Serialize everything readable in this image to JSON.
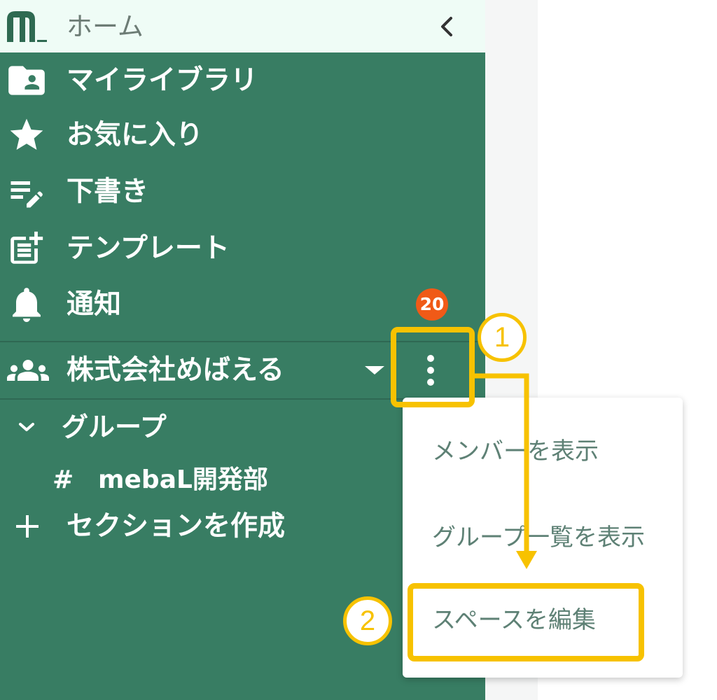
{
  "colors": {
    "sidebar_bg": "#387d63",
    "header_bg": "#effcf6",
    "badge_bg": "#f05a17",
    "annotation": "#f7c200",
    "menu_text": "#5e8175"
  },
  "header": {
    "title": "ホーム",
    "logo_icon": "app-logo-icon",
    "collapse_icon": "chevron-left-icon"
  },
  "nav": {
    "items": [
      {
        "label": "マイライブラリ",
        "icon": "library-icon"
      },
      {
        "label": "お気に入り",
        "icon": "star-icon"
      },
      {
        "label": "下書き",
        "icon": "draft-icon"
      },
      {
        "label": "テンプレート",
        "icon": "template-icon"
      },
      {
        "label": "通知",
        "icon": "bell-icon",
        "badge": "20"
      }
    ]
  },
  "space": {
    "name": "株式会社めばえる",
    "icon": "group-icon",
    "expand_icon": "caret-down-icon",
    "menu_icon": "more-vert-icon"
  },
  "groups": {
    "label": "グループ",
    "toggle_icon": "chevron-down-icon",
    "items": [
      {
        "prefix": "#",
        "name": "mebaL開発部"
      }
    ]
  },
  "create_section": {
    "icon": "plus-icon",
    "label": "セクションを作成"
  },
  "context_menu": {
    "items": [
      {
        "label": "メンバーを表示"
      },
      {
        "label": "グループ一覧を表示"
      },
      {
        "label": "スペースを編集"
      }
    ]
  },
  "annotations": {
    "step_1": "1",
    "step_2": "2"
  }
}
